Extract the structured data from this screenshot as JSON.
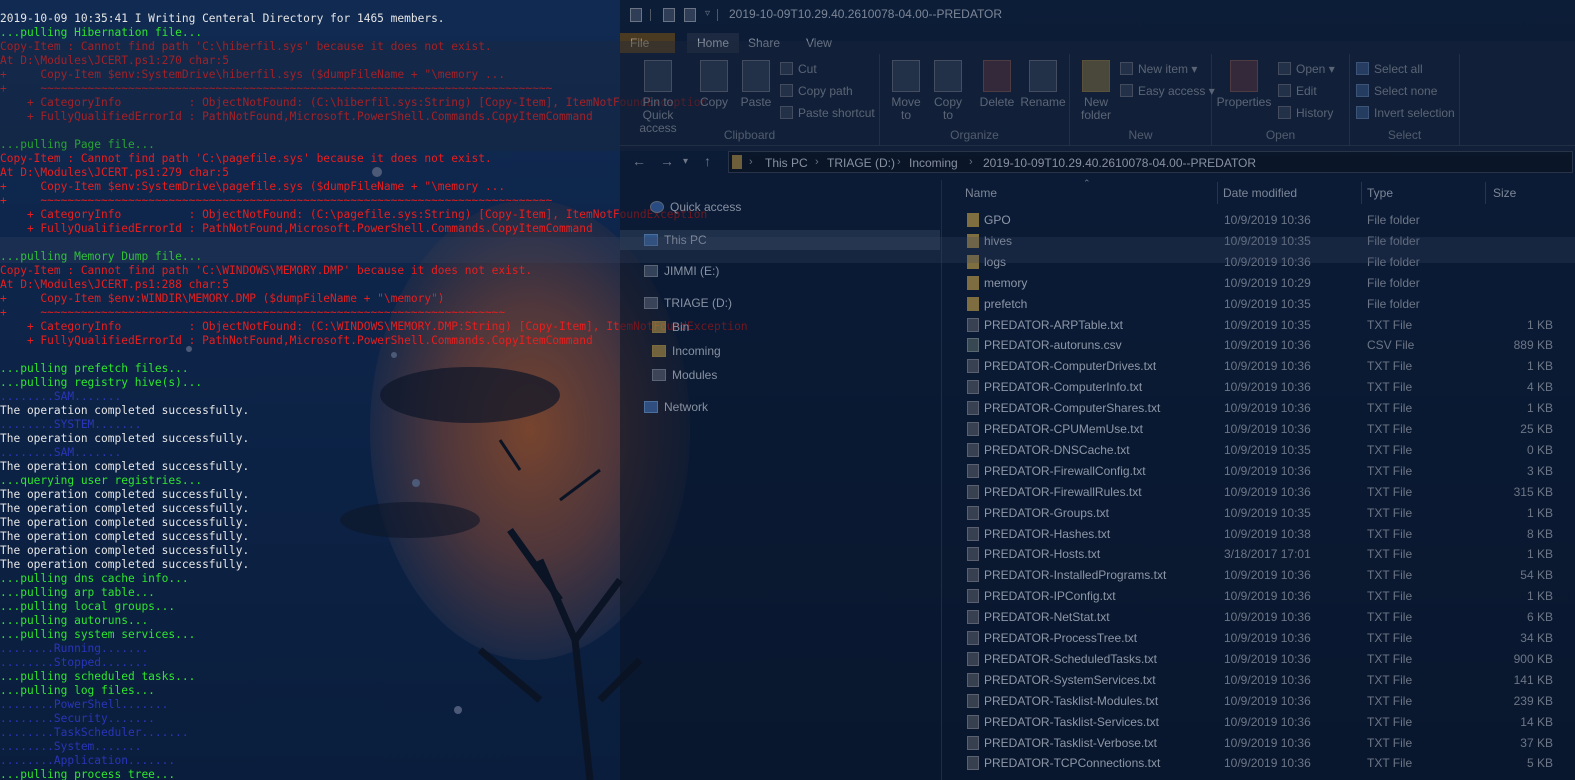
{
  "console": {
    "lines": [
      {
        "text": "2019-10-09 10:35:41 I Writing Centeral Directory for 1465 members.",
        "color": "white"
      },
      {
        "text": "...pulling Hibernation file...",
        "color": "green"
      },
      {
        "text": "Copy-Item : Cannot find path 'C:\\hiberfil.sys' because it does not exist.",
        "color": "red"
      },
      {
        "text": "At D:\\Modules\\JCERT.ps1:270 char:5",
        "color": "red"
      },
      {
        "text": "+     Copy-Item $env:SystemDrive\\hiberfil.sys ($dumpFileName + \"\\memory ...",
        "color": "red"
      },
      {
        "text": "+     ~~~~~~~~~~~~~~~~~~~~~~~~~~~~~~~~~~~~~~~~~~~~~~~~~~~~~~~~~~~~~~~~~~~~~~~~~~~~",
        "color": "red"
      },
      {
        "text": "    + CategoryInfo          : ObjectNotFound: (C:\\hiberfil.sys:String) [Copy-Item], ItemNotFoundException",
        "color": "red"
      },
      {
        "text": "    + FullyQualifiedErrorId : PathNotFound,Microsoft.PowerShell.Commands.CopyItemCommand",
        "color": "red"
      },
      {
        "text": "",
        "color": "blank"
      },
      {
        "text": "...pulling Page file...",
        "color": "green"
      },
      {
        "text": "Copy-Item : Cannot find path 'C:\\pagefile.sys' because it does not exist.",
        "color": "red"
      },
      {
        "text": "At D:\\Modules\\JCERT.ps1:279 char:5",
        "color": "red"
      },
      {
        "text": "+     Copy-Item $env:SystemDrive\\pagefile.sys ($dumpFileName + \"\\memory ...",
        "color": "red"
      },
      {
        "text": "+     ~~~~~~~~~~~~~~~~~~~~~~~~~~~~~~~~~~~~~~~~~~~~~~~~~~~~~~~~~~~~~~~~~~~~~~~~~~~~",
        "color": "red"
      },
      {
        "text": "    + CategoryInfo          : ObjectNotFound: (C:\\pagefile.sys:String) [Copy-Item], ItemNotFoundException",
        "color": "red"
      },
      {
        "text": "    + FullyQualifiedErrorId : PathNotFound,Microsoft.PowerShell.Commands.CopyItemCommand",
        "color": "red"
      },
      {
        "text": "",
        "color": "blank"
      },
      {
        "text": "...pulling Memory Dump file...",
        "color": "green"
      },
      {
        "text": "Copy-Item : Cannot find path 'C:\\WINDOWS\\MEMORY.DMP' because it does not exist.",
        "color": "red"
      },
      {
        "text": "At D:\\Modules\\JCERT.ps1:288 char:5",
        "color": "red"
      },
      {
        "text": "+     Copy-Item $env:WINDIR\\MEMORY.DMP ($dumpFileName + \"\\memory\")",
        "color": "red"
      },
      {
        "text": "+     ~~~~~~~~~~~~~~~~~~~~~~~~~~~~~~~~~~~~~~~~~~~~~~~~~~~~~~~~~~~~~~~~~~~~~",
        "color": "red"
      },
      {
        "text": "    + CategoryInfo          : ObjectNotFound: (C:\\WINDOWS\\MEMORY.DMP:String) [Copy-Item], ItemNotFoundException",
        "color": "red"
      },
      {
        "text": "    + FullyQualifiedErrorId : PathNotFound,Microsoft.PowerShell.Commands.CopyItemCommand",
        "color": "red"
      },
      {
        "text": "",
        "color": "blank"
      },
      {
        "text": "...pulling prefetch files...",
        "color": "green"
      },
      {
        "text": "...pulling registry hive(s)...",
        "color": "green"
      },
      {
        "text": "........SAM.......",
        "color": "blue"
      },
      {
        "text": "The operation completed successfully.",
        "color": "white"
      },
      {
        "text": "........SYSTEM.......",
        "color": "blue"
      },
      {
        "text": "The operation completed successfully.",
        "color": "white"
      },
      {
        "text": "........SAM.......",
        "color": "blue"
      },
      {
        "text": "The operation completed successfully.",
        "color": "white"
      },
      {
        "text": "...querying user registries...",
        "color": "green"
      },
      {
        "text": "The operation completed successfully.",
        "color": "white"
      },
      {
        "text": "The operation completed successfully.",
        "color": "white"
      },
      {
        "text": "The operation completed successfully.",
        "color": "white"
      },
      {
        "text": "The operation completed successfully.",
        "color": "white"
      },
      {
        "text": "The operation completed successfully.",
        "color": "white"
      },
      {
        "text": "The operation completed successfully.",
        "color": "white"
      },
      {
        "text": "...pulling dns cache info...",
        "color": "green"
      },
      {
        "text": "...pulling arp table...",
        "color": "green"
      },
      {
        "text": "...pulling local groups...",
        "color": "green"
      },
      {
        "text": "...pulling autoruns...",
        "color": "green"
      },
      {
        "text": "...pulling system services...",
        "color": "green"
      },
      {
        "text": "........Running.......",
        "color": "blue"
      },
      {
        "text": "........Stopped.......",
        "color": "blue"
      },
      {
        "text": "...pulling scheduled tasks...",
        "color": "green"
      },
      {
        "text": "...pulling log files...",
        "color": "green"
      },
      {
        "text": "........PowerShell.......",
        "color": "blue"
      },
      {
        "text": "........Security.......",
        "color": "blue"
      },
      {
        "text": "........TaskScheduler.......",
        "color": "blue"
      },
      {
        "text": "........System.......",
        "color": "blue"
      },
      {
        "text": "........Application.......",
        "color": "blue"
      },
      {
        "text": "...pulling process tree...",
        "color": "green"
      }
    ]
  },
  "explorer": {
    "title": "2019-10-09T10.29.40.2610078-04.00--PREDATOR",
    "ribbon_tabs": [
      "File",
      "Home",
      "Share",
      "View"
    ],
    "clipboard": {
      "pin": "Pin to Quick access",
      "copy": "Copy",
      "paste": "Paste",
      "cut": "Cut",
      "copy_path": "Copy path",
      "paste_shortcut": "Paste shortcut",
      "label": "Clipboard"
    },
    "organize": {
      "move_to": "Move to",
      "copy_to": "Copy to",
      "delete": "Delete",
      "rename": "Rename",
      "label": "Organize"
    },
    "new": {
      "new_folder": "New folder",
      "new_item": "New item",
      "easy_access": "Easy access",
      "label": "New"
    },
    "open": {
      "properties": "Properties",
      "open": "Open",
      "edit": "Edit",
      "history": "History",
      "label": "Open"
    },
    "select": {
      "select_all": "Select all",
      "select_none": "Select none",
      "invert_selection": "Invert selection",
      "label": "Select"
    },
    "breadcrumb": [
      "This PC",
      "TRIAGE (D:)",
      "Incoming",
      "2019-10-09T10.29.40.2610078-04.00--PREDATOR"
    ],
    "nav": {
      "quick_access": "Quick access",
      "this_pc": "This PC",
      "jimmi": "JIMMI (E:)",
      "triage": "TRIAGE (D:)",
      "bin": "Bin",
      "incoming": "Incoming",
      "modules": "Modules",
      "network": "Network"
    },
    "columns": [
      "Name",
      "Date modified",
      "Type",
      "Size"
    ],
    "files": [
      {
        "name": "GPO",
        "date": "10/9/2019 10:36",
        "type": "File folder",
        "size": "",
        "kind": "folder"
      },
      {
        "name": "hives",
        "date": "10/9/2019 10:35",
        "type": "File folder",
        "size": "",
        "kind": "folder"
      },
      {
        "name": "logs",
        "date": "10/9/2019 10:36",
        "type": "File folder",
        "size": "",
        "kind": "folder"
      },
      {
        "name": "memory",
        "date": "10/9/2019 10:29",
        "type": "File folder",
        "size": "",
        "kind": "folder"
      },
      {
        "name": "prefetch",
        "date": "10/9/2019 10:35",
        "type": "File folder",
        "size": "",
        "kind": "folder"
      },
      {
        "name": "PREDATOR-ARPTable.txt",
        "date": "10/9/2019 10:35",
        "type": "TXT File",
        "size": "1 KB",
        "kind": "txt"
      },
      {
        "name": "PREDATOR-autoruns.csv",
        "date": "10/9/2019 10:36",
        "type": "CSV File",
        "size": "889 KB",
        "kind": "csv"
      },
      {
        "name": "PREDATOR-ComputerDrives.txt",
        "date": "10/9/2019 10:36",
        "type": "TXT File",
        "size": "1 KB",
        "kind": "txt"
      },
      {
        "name": "PREDATOR-ComputerInfo.txt",
        "date": "10/9/2019 10:36",
        "type": "TXT File",
        "size": "4 KB",
        "kind": "txt"
      },
      {
        "name": "PREDATOR-ComputerShares.txt",
        "date": "10/9/2019 10:36",
        "type": "TXT File",
        "size": "1 KB",
        "kind": "txt"
      },
      {
        "name": "PREDATOR-CPUMemUse.txt",
        "date": "10/9/2019 10:36",
        "type": "TXT File",
        "size": "25 KB",
        "kind": "txt"
      },
      {
        "name": "PREDATOR-DNSCache.txt",
        "date": "10/9/2019 10:35",
        "type": "TXT File",
        "size": "0 KB",
        "kind": "txt"
      },
      {
        "name": "PREDATOR-FirewallConfig.txt",
        "date": "10/9/2019 10:36",
        "type": "TXT File",
        "size": "3 KB",
        "kind": "txt"
      },
      {
        "name": "PREDATOR-FirewallRules.txt",
        "date": "10/9/2019 10:36",
        "type": "TXT File",
        "size": "315 KB",
        "kind": "txt"
      },
      {
        "name": "PREDATOR-Groups.txt",
        "date": "10/9/2019 10:35",
        "type": "TXT File",
        "size": "1 KB",
        "kind": "txt"
      },
      {
        "name": "PREDATOR-Hashes.txt",
        "date": "10/9/2019 10:38",
        "type": "TXT File",
        "size": "8 KB",
        "kind": "txt"
      },
      {
        "name": "PREDATOR-Hosts.txt",
        "date": "3/18/2017 17:01",
        "type": "TXT File",
        "size": "1 KB",
        "kind": "txt"
      },
      {
        "name": "PREDATOR-InstalledPrograms.txt",
        "date": "10/9/2019 10:36",
        "type": "TXT File",
        "size": "54 KB",
        "kind": "txt"
      },
      {
        "name": "PREDATOR-IPConfig.txt",
        "date": "10/9/2019 10:36",
        "type": "TXT File",
        "size": "1 KB",
        "kind": "txt"
      },
      {
        "name": "PREDATOR-NetStat.txt",
        "date": "10/9/2019 10:36",
        "type": "TXT File",
        "size": "6 KB",
        "kind": "txt"
      },
      {
        "name": "PREDATOR-ProcessTree.txt",
        "date": "10/9/2019 10:36",
        "type": "TXT File",
        "size": "34 KB",
        "kind": "txt"
      },
      {
        "name": "PREDATOR-ScheduledTasks.txt",
        "date": "10/9/2019 10:36",
        "type": "TXT File",
        "size": "900 KB",
        "kind": "txt"
      },
      {
        "name": "PREDATOR-SystemServices.txt",
        "date": "10/9/2019 10:36",
        "type": "TXT File",
        "size": "141 KB",
        "kind": "txt"
      },
      {
        "name": "PREDATOR-Tasklist-Modules.txt",
        "date": "10/9/2019 10:36",
        "type": "TXT File",
        "size": "239 KB",
        "kind": "txt"
      },
      {
        "name": "PREDATOR-Tasklist-Services.txt",
        "date": "10/9/2019 10:36",
        "type": "TXT File",
        "size": "14 KB",
        "kind": "txt"
      },
      {
        "name": "PREDATOR-Tasklist-Verbose.txt",
        "date": "10/9/2019 10:36",
        "type": "TXT File",
        "size": "37 KB",
        "kind": "txt"
      },
      {
        "name": "PREDATOR-TCPConnections.txt",
        "date": "10/9/2019 10:36",
        "type": "TXT File",
        "size": "5 KB",
        "kind": "txt"
      }
    ]
  }
}
